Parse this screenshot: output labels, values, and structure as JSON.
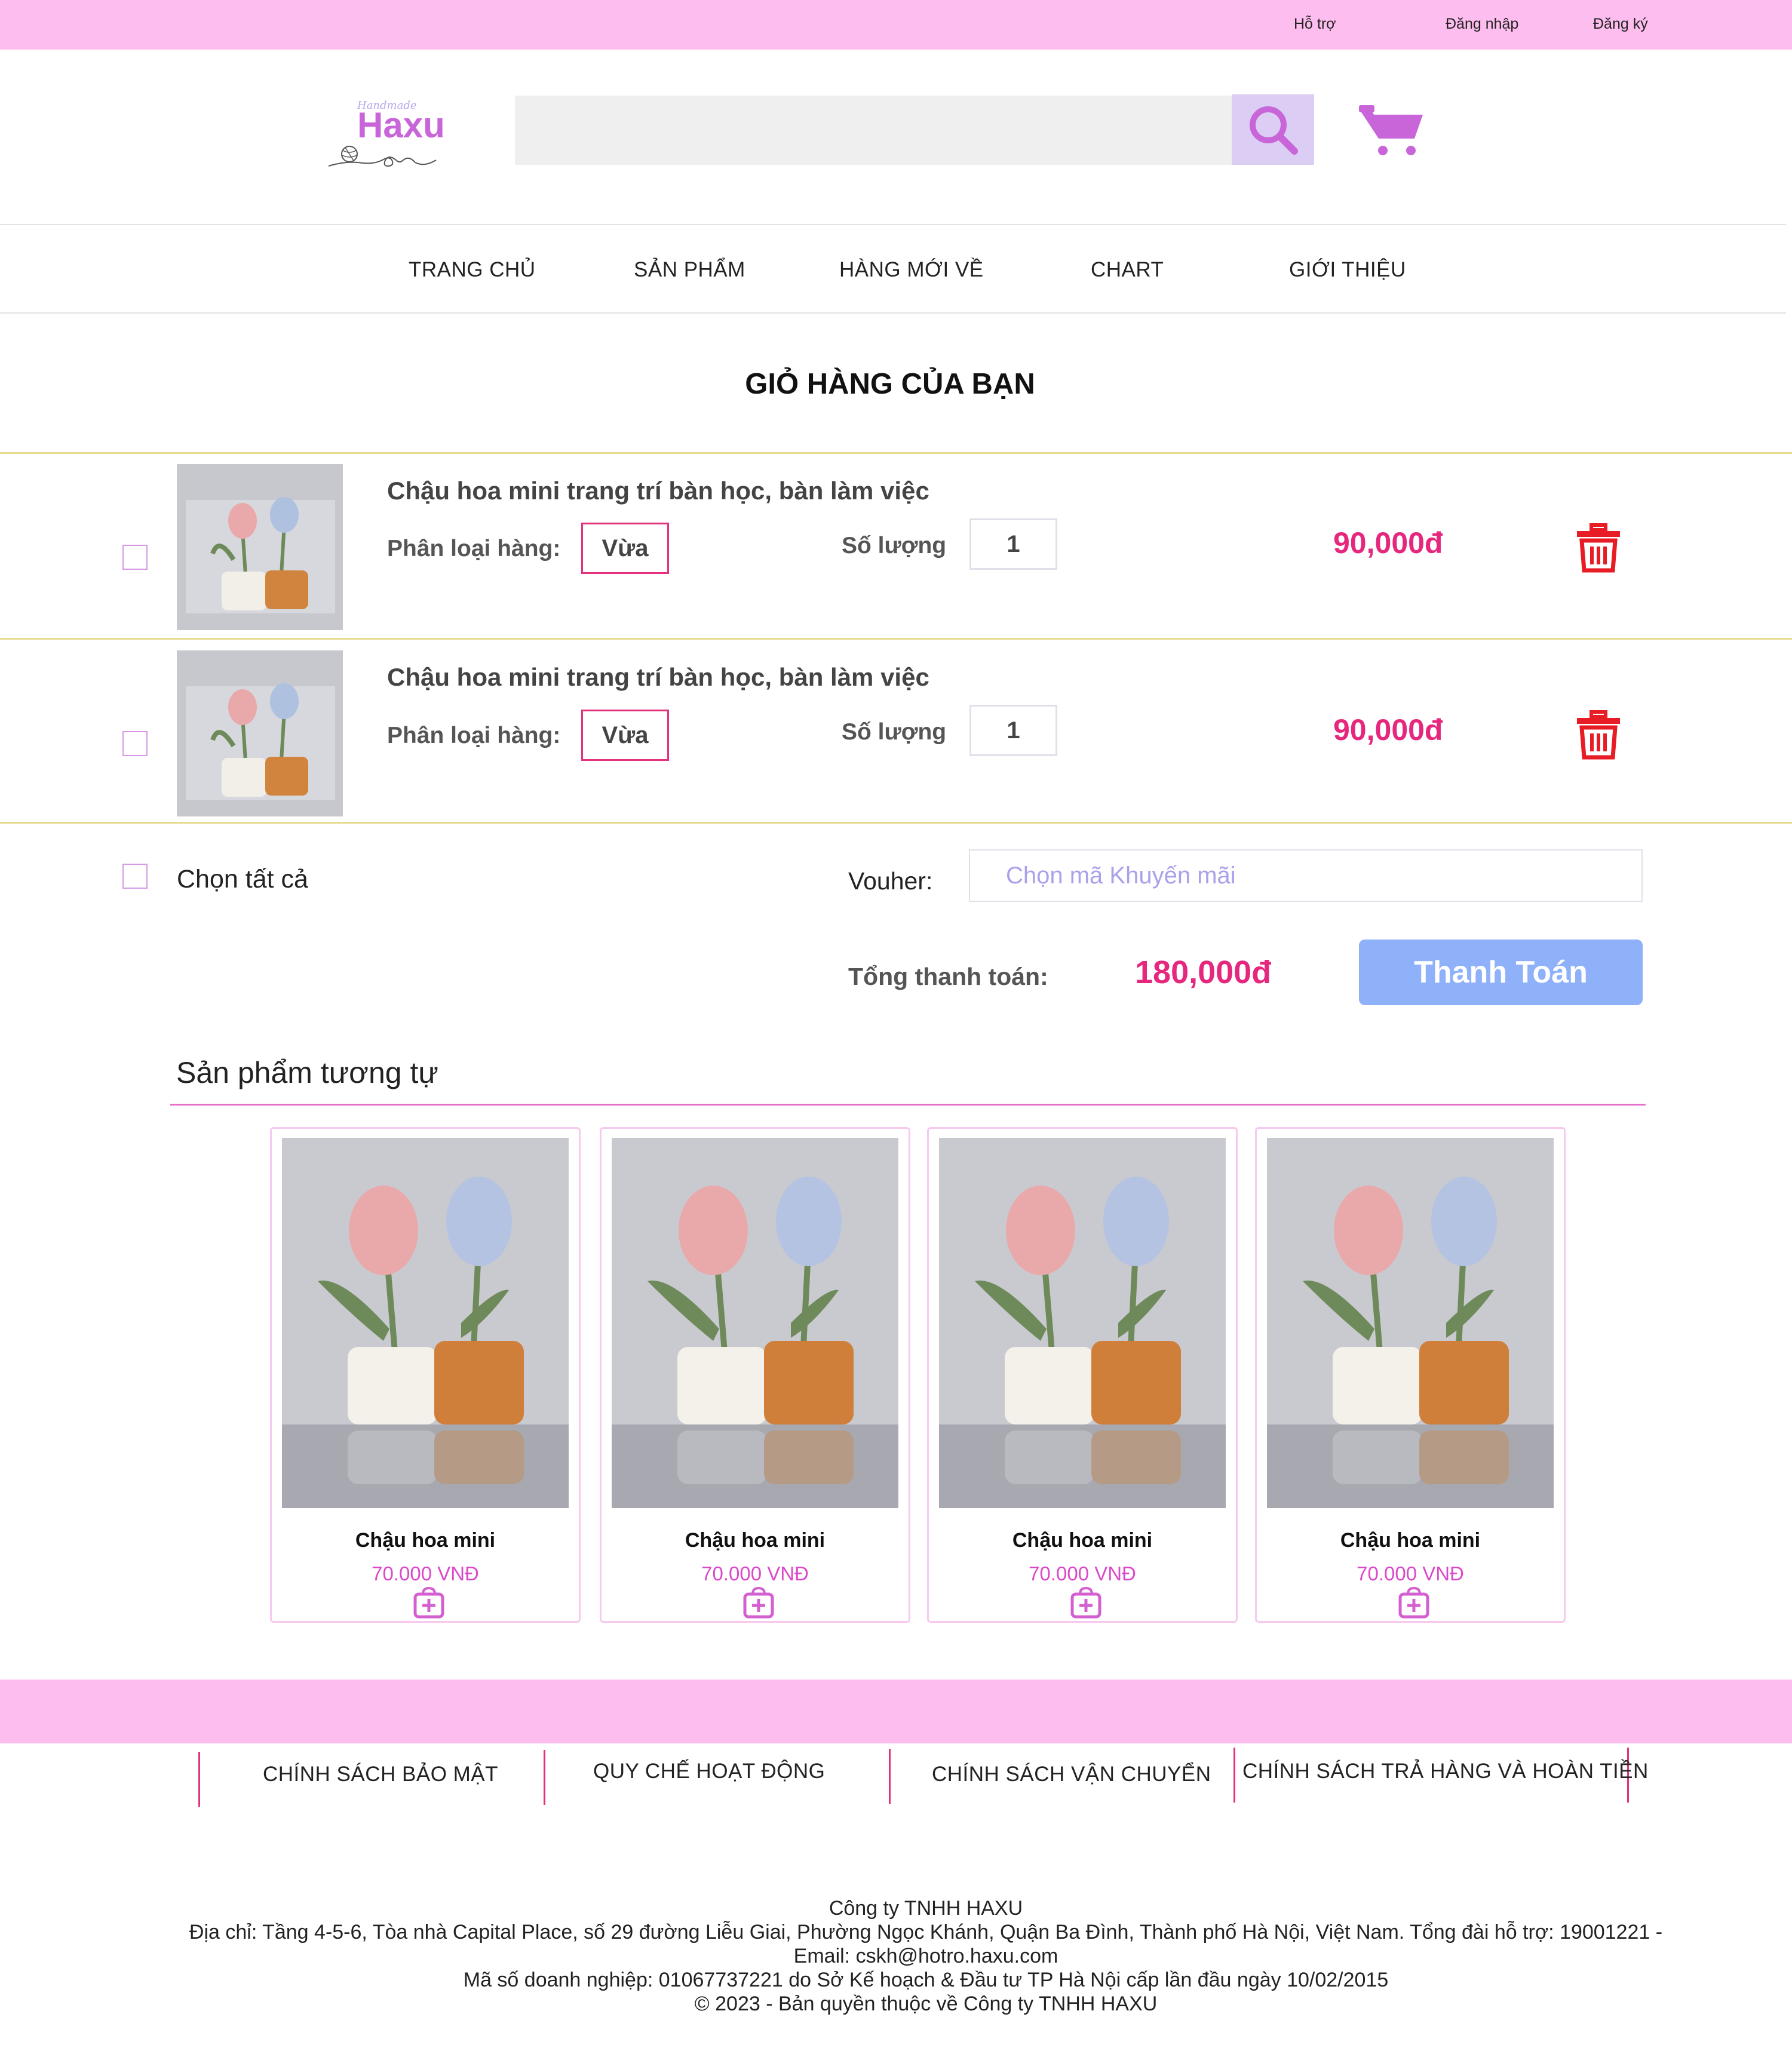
{
  "topbar": {
    "support": "Hỗ trợ",
    "login": "Đăng nhập",
    "register": "Đăng ký"
  },
  "logo": {
    "brand": "Haxu",
    "tagline": "Handmade"
  },
  "search": {
    "placeholder": "",
    "value": ""
  },
  "nav": {
    "items": [
      {
        "label": "TRANG CHỦ"
      },
      {
        "label": "SẢN PHẨM"
      },
      {
        "label": "HÀNG MỚI VỀ"
      },
      {
        "label": "CHART"
      },
      {
        "label": "GIỚI THIỆU"
      }
    ]
  },
  "page_title": "GIỎ HÀNG CỦA BẠN",
  "cart": {
    "variant_label": "Phân loại hàng:",
    "qty_label": "Số lượng",
    "items": [
      {
        "title": "Chậu hoa mini trang trí bàn học, bàn làm việc",
        "variant": "Vừa",
        "quantity": "1",
        "price": "90,000đ",
        "checked": false
      },
      {
        "title": "Chậu hoa mini trang trí bàn học, bàn làm việc",
        "variant": "Vừa",
        "quantity": "1",
        "price": "90,000đ",
        "checked": false
      }
    ],
    "select_all": "Chọn tất cả",
    "voucher_label": "Vouher:",
    "voucher_placeholder": "Chọn mã Khuyến mãi",
    "total_label": "Tổng thanh toán:",
    "total_value": "180,000đ",
    "checkout": "Thanh Toán"
  },
  "similar": {
    "title": "Sản phẩm tương tự",
    "products": [
      {
        "name": "Chậu hoa mini",
        "price": "70.000 VNĐ"
      },
      {
        "name": "Chậu hoa mini",
        "price": "70.000 VNĐ"
      },
      {
        "name": "Chậu hoa mini",
        "price": "70.000 VNĐ"
      },
      {
        "name": "Chậu hoa mini",
        "price": "70.000 VNĐ"
      }
    ]
  },
  "footer": {
    "links": [
      {
        "label": "CHÍNH SÁCH BẢO MẬT"
      },
      {
        "label": "QUY CHẾ HOẠT ĐỘNG"
      },
      {
        "label": "CHÍNH SÁCH VẬN CHUYỂN"
      },
      {
        "label": "CHÍNH SÁCH TRẢ HÀNG VÀ HOÀN TIỀN"
      }
    ],
    "company": "Công ty TNHH HAXU",
    "address": "Địa chỉ: Tầng 4-5-6, Tòa nhà Capital Place, số 29 đường Liễu Giai, Phường Ngọc Khánh, Quận Ba Đình, Thành phố Hà Nội, Việt Nam. Tổng đài hỗ trợ: 19001221 - Email: cskh@hotro.haxu.com",
    "business": "Mã số doanh nghiệp: 01067737221 do Sở Kế hoạch & Đầu tư TP Hà Nội cấp lần đầu ngày 10/02/2015",
    "copyright": "© 2023 - Bản quyền thuộc về Công ty TNHH HAXU"
  },
  "colors": {
    "pink_band": "#fdbdee",
    "price_pink": "#e5287e",
    "accent_purple": "#c865d8",
    "checkout_blue": "#8fb1fa",
    "trash_red": "#e81c24"
  },
  "icons": [
    "search-icon",
    "cart-icon",
    "trash-icon",
    "add-to-cart-icon"
  ]
}
